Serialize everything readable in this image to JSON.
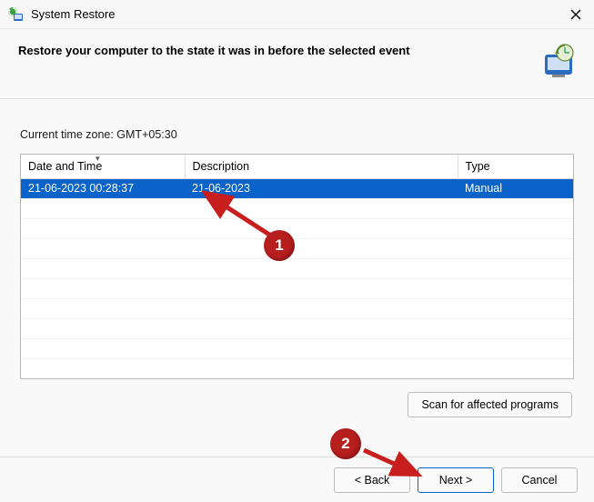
{
  "titlebar": {
    "title": "System Restore"
  },
  "header": {
    "headline": "Restore your computer to the state it was in before the selected event"
  },
  "content": {
    "timezone_text": "Current time zone: GMT+05:30",
    "columns": {
      "date": "Date and Time",
      "desc": "Description",
      "type": "Type"
    },
    "rows": [
      {
        "date": "21-06-2023 00:28:37",
        "desc": "21-06-2023",
        "type": "Manual",
        "selected": true
      }
    ],
    "scan_button": "Scan for affected programs"
  },
  "footer": {
    "back": "< Back",
    "next": "Next >",
    "cancel": "Cancel"
  },
  "annotations": {
    "label1": "1",
    "label2": "2"
  }
}
